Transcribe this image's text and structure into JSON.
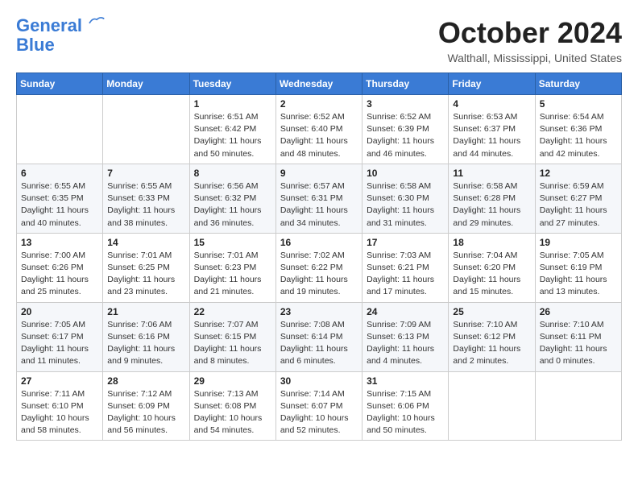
{
  "header": {
    "logo_line1": "General",
    "logo_line2": "Blue",
    "month_title": "October 2024",
    "location": "Walthall, Mississippi, United States"
  },
  "weekdays": [
    "Sunday",
    "Monday",
    "Tuesday",
    "Wednesday",
    "Thursday",
    "Friday",
    "Saturday"
  ],
  "weeks": [
    [
      {
        "day": "",
        "info": ""
      },
      {
        "day": "",
        "info": ""
      },
      {
        "day": "1",
        "info": "Sunrise: 6:51 AM\nSunset: 6:42 PM\nDaylight: 11 hours and 50 minutes."
      },
      {
        "day": "2",
        "info": "Sunrise: 6:52 AM\nSunset: 6:40 PM\nDaylight: 11 hours and 48 minutes."
      },
      {
        "day": "3",
        "info": "Sunrise: 6:52 AM\nSunset: 6:39 PM\nDaylight: 11 hours and 46 minutes."
      },
      {
        "day": "4",
        "info": "Sunrise: 6:53 AM\nSunset: 6:37 PM\nDaylight: 11 hours and 44 minutes."
      },
      {
        "day": "5",
        "info": "Sunrise: 6:54 AM\nSunset: 6:36 PM\nDaylight: 11 hours and 42 minutes."
      }
    ],
    [
      {
        "day": "6",
        "info": "Sunrise: 6:55 AM\nSunset: 6:35 PM\nDaylight: 11 hours and 40 minutes."
      },
      {
        "day": "7",
        "info": "Sunrise: 6:55 AM\nSunset: 6:33 PM\nDaylight: 11 hours and 38 minutes."
      },
      {
        "day": "8",
        "info": "Sunrise: 6:56 AM\nSunset: 6:32 PM\nDaylight: 11 hours and 36 minutes."
      },
      {
        "day": "9",
        "info": "Sunrise: 6:57 AM\nSunset: 6:31 PM\nDaylight: 11 hours and 34 minutes."
      },
      {
        "day": "10",
        "info": "Sunrise: 6:58 AM\nSunset: 6:30 PM\nDaylight: 11 hours and 31 minutes."
      },
      {
        "day": "11",
        "info": "Sunrise: 6:58 AM\nSunset: 6:28 PM\nDaylight: 11 hours and 29 minutes."
      },
      {
        "day": "12",
        "info": "Sunrise: 6:59 AM\nSunset: 6:27 PM\nDaylight: 11 hours and 27 minutes."
      }
    ],
    [
      {
        "day": "13",
        "info": "Sunrise: 7:00 AM\nSunset: 6:26 PM\nDaylight: 11 hours and 25 minutes."
      },
      {
        "day": "14",
        "info": "Sunrise: 7:01 AM\nSunset: 6:25 PM\nDaylight: 11 hours and 23 minutes."
      },
      {
        "day": "15",
        "info": "Sunrise: 7:01 AM\nSunset: 6:23 PM\nDaylight: 11 hours and 21 minutes."
      },
      {
        "day": "16",
        "info": "Sunrise: 7:02 AM\nSunset: 6:22 PM\nDaylight: 11 hours and 19 minutes."
      },
      {
        "day": "17",
        "info": "Sunrise: 7:03 AM\nSunset: 6:21 PM\nDaylight: 11 hours and 17 minutes."
      },
      {
        "day": "18",
        "info": "Sunrise: 7:04 AM\nSunset: 6:20 PM\nDaylight: 11 hours and 15 minutes."
      },
      {
        "day": "19",
        "info": "Sunrise: 7:05 AM\nSunset: 6:19 PM\nDaylight: 11 hours and 13 minutes."
      }
    ],
    [
      {
        "day": "20",
        "info": "Sunrise: 7:05 AM\nSunset: 6:17 PM\nDaylight: 11 hours and 11 minutes."
      },
      {
        "day": "21",
        "info": "Sunrise: 7:06 AM\nSunset: 6:16 PM\nDaylight: 11 hours and 9 minutes."
      },
      {
        "day": "22",
        "info": "Sunrise: 7:07 AM\nSunset: 6:15 PM\nDaylight: 11 hours and 8 minutes."
      },
      {
        "day": "23",
        "info": "Sunrise: 7:08 AM\nSunset: 6:14 PM\nDaylight: 11 hours and 6 minutes."
      },
      {
        "day": "24",
        "info": "Sunrise: 7:09 AM\nSunset: 6:13 PM\nDaylight: 11 hours and 4 minutes."
      },
      {
        "day": "25",
        "info": "Sunrise: 7:10 AM\nSunset: 6:12 PM\nDaylight: 11 hours and 2 minutes."
      },
      {
        "day": "26",
        "info": "Sunrise: 7:10 AM\nSunset: 6:11 PM\nDaylight: 11 hours and 0 minutes."
      }
    ],
    [
      {
        "day": "27",
        "info": "Sunrise: 7:11 AM\nSunset: 6:10 PM\nDaylight: 10 hours and 58 minutes."
      },
      {
        "day": "28",
        "info": "Sunrise: 7:12 AM\nSunset: 6:09 PM\nDaylight: 10 hours and 56 minutes."
      },
      {
        "day": "29",
        "info": "Sunrise: 7:13 AM\nSunset: 6:08 PM\nDaylight: 10 hours and 54 minutes."
      },
      {
        "day": "30",
        "info": "Sunrise: 7:14 AM\nSunset: 6:07 PM\nDaylight: 10 hours and 52 minutes."
      },
      {
        "day": "31",
        "info": "Sunrise: 7:15 AM\nSunset: 6:06 PM\nDaylight: 10 hours and 50 minutes."
      },
      {
        "day": "",
        "info": ""
      },
      {
        "day": "",
        "info": ""
      }
    ]
  ]
}
